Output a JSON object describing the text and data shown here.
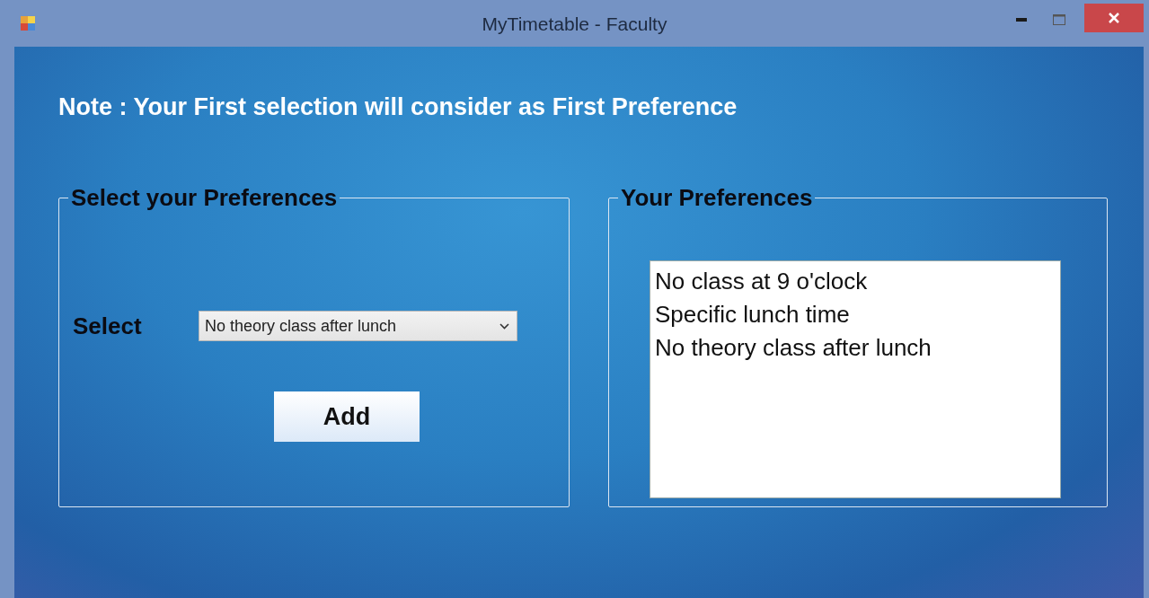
{
  "window": {
    "title": "MyTimetable - Faculty"
  },
  "note": "Note : Your First selection will consider as First Preference",
  "select_group": {
    "title": "Select your Preferences",
    "label": "Select",
    "dropdown_value": "No theory class after lunch",
    "button": "Add"
  },
  "preferences_group": {
    "title": "Your Preferences",
    "items": [
      {
        "label": "No class at 9 o'clock"
      },
      {
        "label": "Specific lunch time"
      },
      {
        "label": "No theory class after lunch"
      }
    ]
  }
}
